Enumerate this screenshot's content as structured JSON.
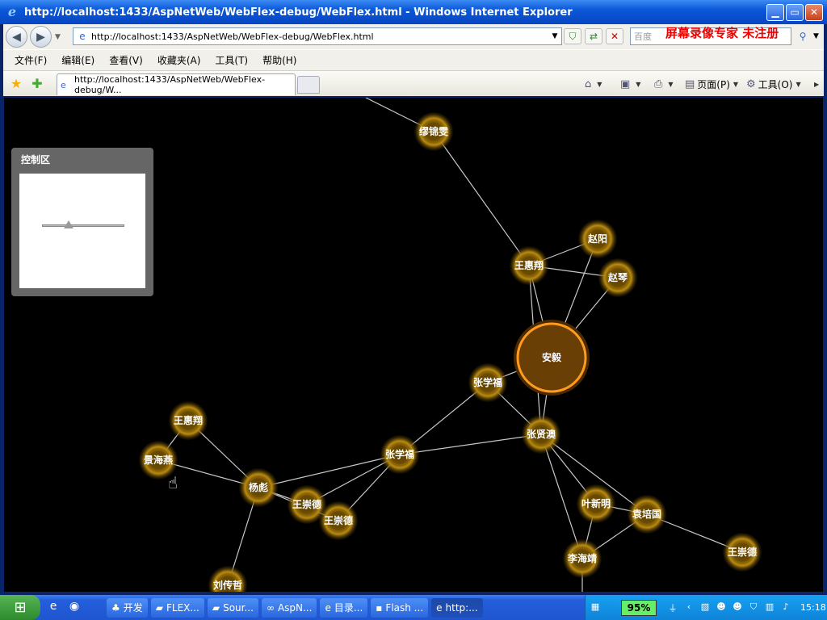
{
  "window": {
    "title": "http://localhost:1433/AspNetWeb/WebFlex-debug/WebFlex.html - Windows Internet Explorer"
  },
  "address": {
    "url": "http://localhost:1433/AspNetWeb/WebFlex-debug/WebFlex.html"
  },
  "search": {
    "placeholder": "百度"
  },
  "watermark": "屏幕录像专家  未注册",
  "menu": [
    "文件(F)",
    "编辑(E)",
    "查看(V)",
    "收藏夹(A)",
    "工具(T)",
    "帮助(H)"
  ],
  "tab": {
    "title": "http://localhost:1433/AspNetWeb/WebFlex-debug/W..."
  },
  "toolbar": {
    "page": "页面(P)",
    "tools": "工具(O)"
  },
  "control_panel": {
    "title": "控制区",
    "zoom_level": 0.33
  },
  "graph": {
    "nodes": [
      {
        "id": "n1",
        "label": "缪锦雯"
      },
      {
        "id": "n2",
        "label": "赵阳"
      },
      {
        "id": "n3",
        "label": "王惠翔"
      },
      {
        "id": "n4",
        "label": "赵琴"
      },
      {
        "id": "n5",
        "label": "安毅",
        "center": true
      },
      {
        "id": "n6",
        "label": "张学福"
      },
      {
        "id": "n7",
        "label": "张贤澳"
      },
      {
        "id": "n8",
        "label": "张学福"
      },
      {
        "id": "n9",
        "label": "王惠翔"
      },
      {
        "id": "n10",
        "label": "景海燕"
      },
      {
        "id": "n11",
        "label": "杨彪"
      },
      {
        "id": "n12",
        "label": "王崇德"
      },
      {
        "id": "n13",
        "label": "王崇德"
      },
      {
        "id": "n14",
        "label": "叶新明"
      },
      {
        "id": "n15",
        "label": "袁培国"
      },
      {
        "id": "n16",
        "label": "李海靖"
      },
      {
        "id": "n17",
        "label": "王崇德"
      },
      {
        "id": "n18",
        "label": "刘传哲"
      }
    ],
    "edges": [
      [
        "n1",
        "n3"
      ],
      [
        "n3",
        "n2"
      ],
      [
        "n3",
        "n4"
      ],
      [
        "n3",
        "n5"
      ],
      [
        "n2",
        "n5"
      ],
      [
        "n4",
        "n5"
      ],
      [
        "n3",
        "n7"
      ],
      [
        "n5",
        "n6"
      ],
      [
        "n5",
        "n7"
      ],
      [
        "n6",
        "n7"
      ],
      [
        "n6",
        "n8"
      ],
      [
        "n7",
        "n8"
      ],
      [
        "n7",
        "n14"
      ],
      [
        "n7",
        "n15"
      ],
      [
        "n7",
        "n16"
      ],
      [
        "n14",
        "n15"
      ],
      [
        "n14",
        "n16"
      ],
      [
        "n15",
        "n16"
      ],
      [
        "n15",
        "n17"
      ],
      [
        "n8",
        "n11"
      ],
      [
        "n8",
        "n12"
      ],
      [
        "n8",
        "n13"
      ],
      [
        "n11",
        "n12"
      ],
      [
        "n11",
        "n13"
      ],
      [
        "n11",
        "n9"
      ],
      [
        "n11",
        "n10"
      ],
      [
        "n9",
        "n10"
      ],
      [
        "n11",
        "n18"
      ]
    ]
  },
  "taskbar": {
    "items": [
      "开发",
      "FLEX...",
      "Sour...",
      "AspN...",
      "目录...",
      "Flash ...",
      "http:..."
    ],
    "battery": "95%",
    "clock": "15:18"
  }
}
